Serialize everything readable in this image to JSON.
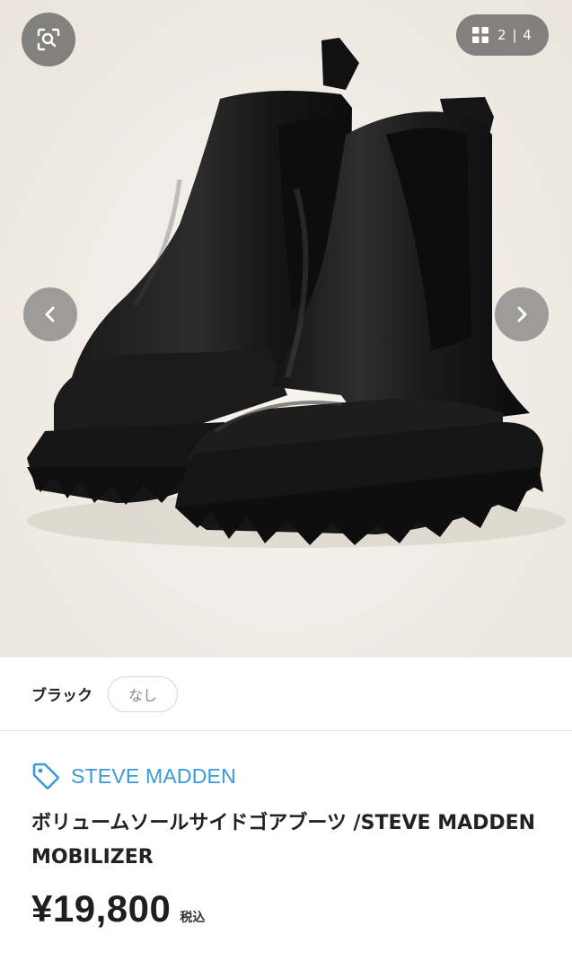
{
  "gallery": {
    "counter": "2 | 4",
    "image_alt": "black chelsea boots with lug soles"
  },
  "icons": {
    "zoom": "search-zoom-icon",
    "grid": "grid-icon",
    "prev": "chevron-left-icon",
    "next": "chevron-right-icon",
    "brand_tag": "tag-icon"
  },
  "variant": {
    "color_label": "ブラック",
    "size_option": "なし"
  },
  "product": {
    "brand": "STEVE MADDEN",
    "title": "ボリュームソールサイドゴアブーツ /STEVE MADDEN MOBILIZER",
    "price": "¥19,800",
    "tax_label": "税込"
  },
  "colors": {
    "brand_accent": "#3a9ad9",
    "overlay": "#6e6e6e"
  }
}
